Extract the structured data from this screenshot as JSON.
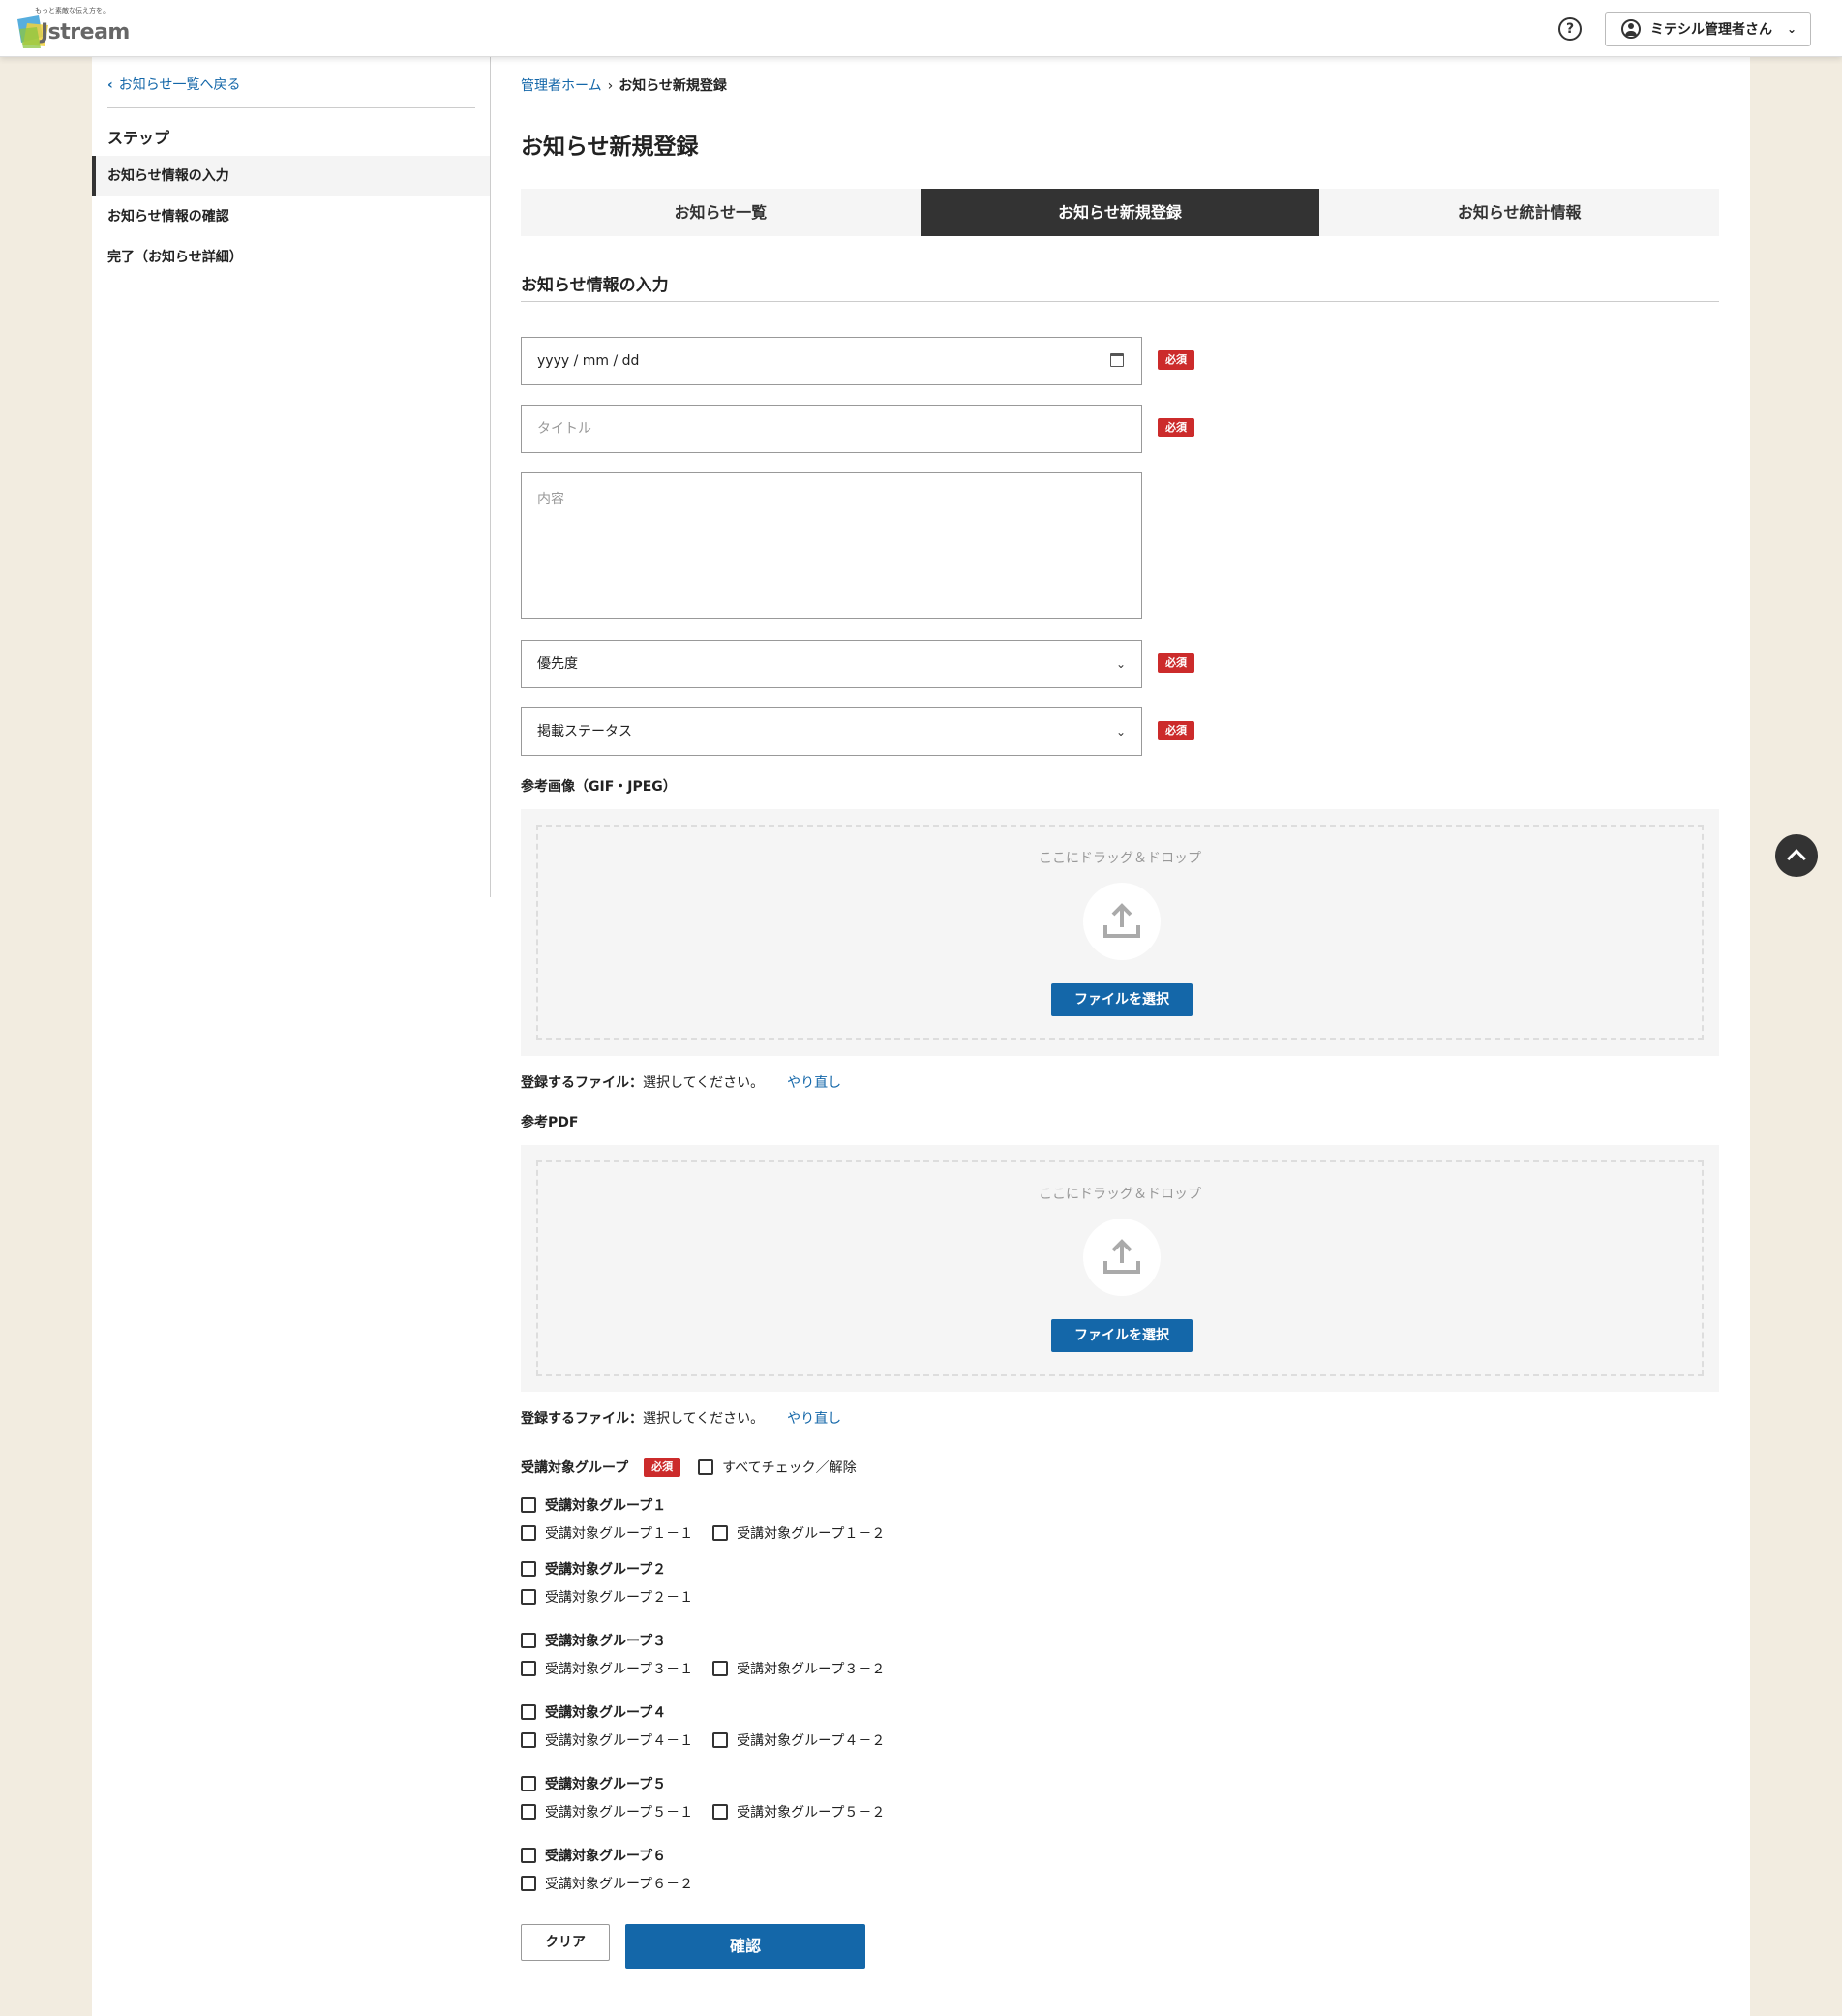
{
  "header": {
    "logo_tagline": "もっと素敵な伝え方を。",
    "logo_text": "Jstream",
    "help_label": "?",
    "user_name": "ミテシル管理者さん",
    "user_chevron": "⌄"
  },
  "sidebar": {
    "back_label": "お知らせ一覧へ戻る",
    "steps_title": "ステップ",
    "steps": [
      {
        "label": "お知らせ情報の入力",
        "active": true
      },
      {
        "label": "お知らせ情報の確認",
        "active": false
      },
      {
        "label": "完了（お知らせ詳細）",
        "active": false
      }
    ]
  },
  "breadcrumb": {
    "home": "管理者ホーム",
    "current": "お知らせ新規登録"
  },
  "page_title": "お知らせ新規登録",
  "tabs": [
    {
      "label": "お知らせ一覧",
      "active": false
    },
    {
      "label": "お知らせ新規登録",
      "active": true
    },
    {
      "label": "お知らせ統計情報",
      "active": false
    }
  ],
  "section_title": "お知らせ情報の入力",
  "form": {
    "date_placeholder": "yyyy / mm / dd",
    "title_placeholder": "タイトル",
    "content_placeholder": "内容",
    "priority_placeholder": "優先度",
    "status_placeholder": "掲載ステータス",
    "required_label": "必須"
  },
  "image_upload": {
    "label": "参考画像（GIF・JPEG）",
    "drop_text": "ここにドラッグ＆ドロップ",
    "button_label": "ファイルを選択",
    "file_key": "登録するファイル：",
    "file_value": "選択してください。",
    "redo_label": "やり直し"
  },
  "pdf_upload": {
    "label": "参考PDF",
    "drop_text": "ここにドラッグ＆ドロップ",
    "button_label": "ファイルを選択",
    "file_key": "登録するファイル：",
    "file_value": "選択してください。",
    "redo_label": "やり直し"
  },
  "groups": {
    "label": "受講対象グループ",
    "required_label": "必須",
    "check_all_label": "すべてチェック／解除",
    "items": [
      {
        "name": "受講対象グループ１",
        "children": [
          "受講対象グループ１－１",
          "受講対象グループ１－２"
        ]
      },
      {
        "name": "受講対象グループ２",
        "children": [
          "受講対象グループ２－１"
        ]
      },
      {
        "name": "受講対象グループ３",
        "children": [
          "受講対象グループ３－１",
          "受講対象グループ３－２"
        ]
      },
      {
        "name": "受講対象グループ４",
        "children": [
          "受講対象グループ４－１",
          "受講対象グループ４－２"
        ]
      },
      {
        "name": "受講対象グループ５",
        "children": [
          "受講対象グループ５－１",
          "受講対象グループ５－２"
        ]
      },
      {
        "name": "受講対象グループ６",
        "children": [
          "受講対象グループ６－２"
        ]
      }
    ]
  },
  "actions": {
    "clear_label": "クリア",
    "confirm_label": "確認"
  },
  "colors": {
    "accent": "#1467a9",
    "required": "#cc2b2b",
    "background": "#f2ece0",
    "tab_active": "#333333"
  },
  "icons": {
    "help": "help-icon",
    "user": "user-icon",
    "calendar": "calendar-icon",
    "upload": "upload-icon",
    "scroll_top": "chevron-up-icon"
  }
}
